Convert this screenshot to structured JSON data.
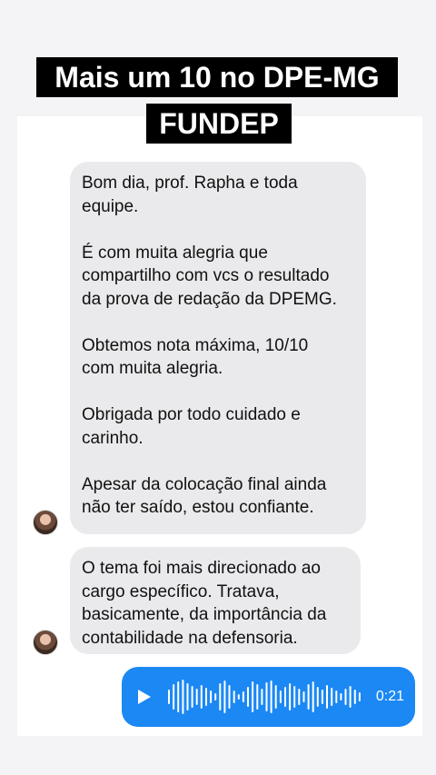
{
  "banner": {
    "line1": "Mais um 10 no DPE-MG",
    "line2": "FUNDEP"
  },
  "messages": [
    {
      "paragraphs": [
        "Bom dia, prof. Rapha e toda\nequipe.",
        "É com muita alegria que\ncompartilho com vcs o resultado\nda prova de redação da DPEMG.",
        "Obtemos nota máxima, 10/10\ncom muita alegria.",
        "Obrigada por todo cuidado e\ncarinho.",
        "Apesar da colocação final ainda\nnão ter saído, estou confiante."
      ]
    },
    {
      "paragraphs": [
        "O tema foi mais direcionado ao\ncargo específico. Tratava,\nbasicamente, da importância da\ncontabilidade na defensoria."
      ]
    }
  ],
  "audio": {
    "duration": "0:21",
    "icon": "play-icon",
    "color": "#1b88f4"
  }
}
